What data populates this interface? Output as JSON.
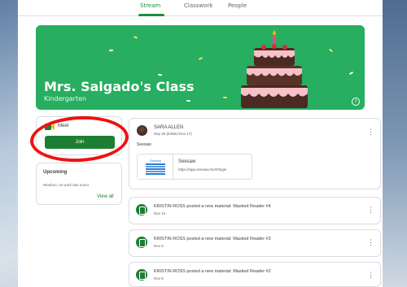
{
  "nav": {
    "tabs": [
      {
        "label": "Stream",
        "active": true
      },
      {
        "label": "Classwork",
        "active": false
      },
      {
        "label": "People",
        "active": false
      }
    ]
  },
  "banner": {
    "title": "Mrs. Salgado's Class",
    "subtitle": "Kindergarten",
    "info_icon": "i"
  },
  "meet": {
    "label": "Meet",
    "join_label": "Join",
    "more_icon": "⋮"
  },
  "upcoming": {
    "title": "Upcoming",
    "empty_text": "Woohoo, no work due soon!",
    "view_all": "View all"
  },
  "post": {
    "author": "SARA ALLEN",
    "date": "Sep 29 (Edited Nov 17)",
    "body": "Seesaw",
    "more_icon": "⋮",
    "attachment": {
      "title": "Seesaw",
      "url": "https://app.seesaw.me/#/login",
      "thumb_label": "Seesaw"
    }
  },
  "materials": [
    {
      "title": "KRISTIN ROSS posted a new material: Masked Reader #4",
      "date": "Nov 10",
      "more_icon": "⋮"
    },
    {
      "title": "KRISTIN ROSS posted a new material: Masked Reader #3",
      "date": "Nov 9",
      "more_icon": "⋮"
    },
    {
      "title": "KRISTIN ROSS posted a new material: Masked Reader #2",
      "date": "Nov 8",
      "more_icon": "⋮"
    }
  ],
  "colors": {
    "accent_green": "#1e7e34",
    "banner_green": "#27ae60",
    "highlight_red": "#ee1111"
  }
}
